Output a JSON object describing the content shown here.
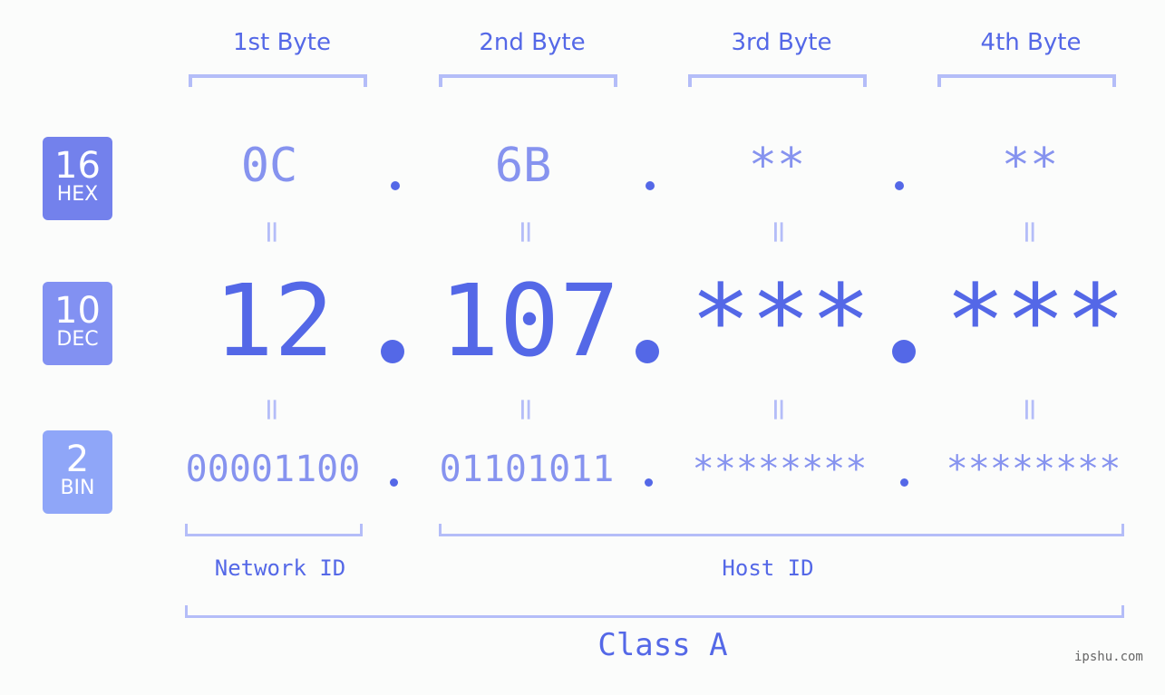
{
  "headers": [
    "1st Byte",
    "2nd Byte",
    "3rd Byte",
    "4th Byte"
  ],
  "badges": {
    "hex": {
      "num": "16",
      "label": "HEX",
      "color": "#7381ec"
    },
    "dec": {
      "num": "10",
      "label": "DEC",
      "color": "#8291f2"
    },
    "bin": {
      "num": "2",
      "label": "BIN",
      "color": "#8fa6f8"
    }
  },
  "hex": [
    "0C",
    "6B",
    "**",
    "**"
  ],
  "dec": [
    "12",
    "107",
    "***",
    "***"
  ],
  "bin": [
    "00001100",
    "01101011",
    "********",
    "********"
  ],
  "equals": "=",
  "network_id_label": "Network ID",
  "host_id_label": "Host ID",
  "class_label": "Class A",
  "watermark": "ipshu.com",
  "colors": {
    "accent": "#5468e7",
    "light": "#8693ef",
    "bracket": "#b4bdf8",
    "background": "#fbfcfb"
  }
}
